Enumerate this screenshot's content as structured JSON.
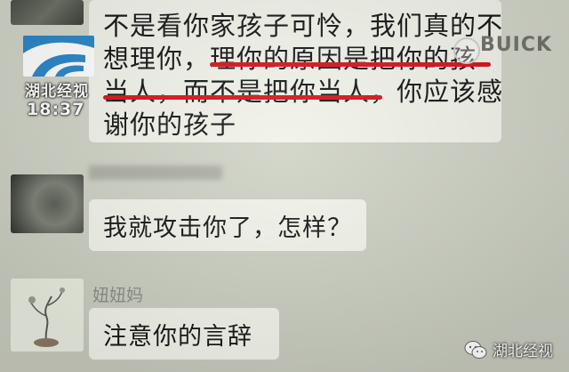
{
  "channel_logo": {
    "name": "湖北经视",
    "time": "18:37"
  },
  "sponsor_logo": {
    "brand": "BUICK"
  },
  "messages": [
    {
      "lines": [
        "不是看你家孩子可怜，我们真的不",
        "想理你，理你的原因是把你的孩",
        "当人，而不是把你当人，你应该感",
        "谢你的孩子"
      ]
    },
    {
      "text": "我就攻击你了，怎样？"
    },
    {
      "sender": "妞妞妈",
      "text": "注意你的言辞"
    }
  ],
  "watermark": {
    "label": "湖北经视"
  },
  "colors": {
    "underline": "#d6121e",
    "bubble": "#f1f3ea",
    "background": "#cfd2c5",
    "logo_blue": "#2a86c9"
  },
  "icons": [
    "tv-station-logo-icon",
    "wechat-official-account-icon",
    "buick-emblem-icon"
  ]
}
